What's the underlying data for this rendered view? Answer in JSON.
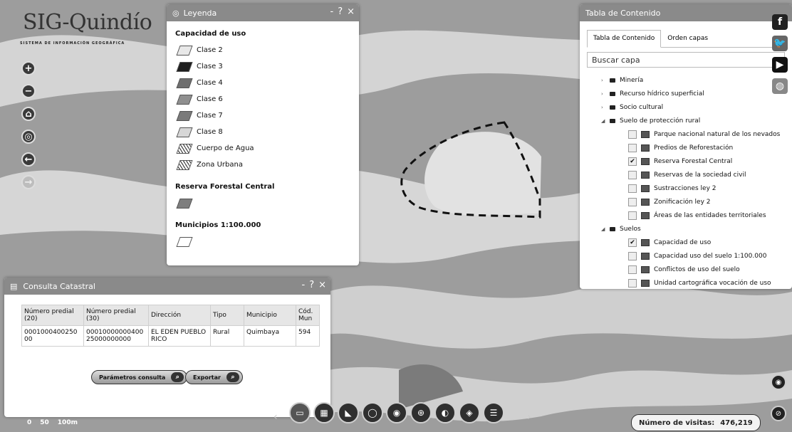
{
  "logo": {
    "title": "SIG-Quindío",
    "subtitle": "SISTEMA DE INFORMACIÓN GEOGRÁFICA"
  },
  "map_controls": [
    {
      "name": "zoom-in-button",
      "glyph": "+"
    },
    {
      "name": "zoom-out-button",
      "glyph": "−"
    },
    {
      "name": "home-button",
      "glyph": "⌂"
    },
    {
      "name": "locate-button",
      "glyph": "◎"
    },
    {
      "name": "back-button",
      "glyph": "←"
    },
    {
      "name": "forward-button",
      "glyph": "→"
    }
  ],
  "legend": {
    "title": "Leyenda",
    "buttons": [
      "-",
      "?",
      "×"
    ],
    "section1": "Capacidad de uso",
    "classes": [
      {
        "label": "Clase 2",
        "color": "#e8e8e8"
      },
      {
        "label": "Clase 3",
        "color": "#1e1e1e"
      },
      {
        "label": "Clase 4",
        "color": "#6f6f6f"
      },
      {
        "label": "Clase 6",
        "color": "#8f8f8f"
      },
      {
        "label": "Clase 7",
        "color": "#7a7a7a"
      },
      {
        "label": "Clase 8",
        "color": "#d7d7d7"
      },
      {
        "label": "Cuerpo de Agua",
        "color": "hatch"
      },
      {
        "label": "Zona Urbana",
        "color": "hatch"
      }
    ],
    "section2": "Reserva Forestal Central",
    "section3": "Municipios 1:100.000"
  },
  "toc": {
    "title": "Tabla de Contenido",
    "tabs": [
      "Tabla de Contenido",
      "Orden capas"
    ],
    "search_placeholder": "Buscar capa",
    "groups": [
      {
        "label": "Minería",
        "expanded": false
      },
      {
        "label": "Recurso hídrico superficial",
        "expanded": false
      },
      {
        "label": "Socio cultural",
        "expanded": false
      },
      {
        "label": "Suelo de protección rural",
        "expanded": true
      }
    ],
    "suelo_children": [
      {
        "label": "Parque nacional natural de los nevados",
        "checked": false
      },
      {
        "label": "Predios de Reforestación",
        "checked": false
      },
      {
        "label": "Reserva Forestal Central",
        "checked": true
      },
      {
        "label": "Reservas de la sociedad civil",
        "checked": false
      },
      {
        "label": "Sustracciones ley 2",
        "checked": false
      },
      {
        "label": "Zonificación ley 2",
        "checked": false
      },
      {
        "label": "Áreas de las entidades territoriales",
        "checked": false
      }
    ],
    "suelos_group": "Suelos",
    "suelos_children": [
      {
        "label": "Capacidad de uso",
        "checked": true
      },
      {
        "label": "Capacidad uso del suelo 1:100.000",
        "checked": false
      },
      {
        "label": "Conflictos de uso del suelo",
        "checked": false
      },
      {
        "label": "Unidad cartográfica vocación de uso",
        "checked": false
      }
    ]
  },
  "social": [
    {
      "name": "facebook-icon",
      "glyph": "f",
      "color": "#222"
    },
    {
      "name": "twitter-icon",
      "glyph": "🐦",
      "color": "#666"
    },
    {
      "name": "youtube-icon",
      "glyph": "▶",
      "color": "#111"
    },
    {
      "name": "map-share-icon",
      "glyph": "◍",
      "color": "#888"
    }
  ],
  "catastral": {
    "title": "Consulta Catastral",
    "buttons": [
      "-",
      "?",
      "×"
    ],
    "headers": [
      "Número predial (20)",
      "Número predial (30)",
      "Dirección",
      "Tipo",
      "Municipio",
      "Cód. Mun"
    ],
    "rows": [
      [
        "000100040025000",
        "0001000000040025000000000",
        "EL EDEN PUEBLO RICO",
        "Rural",
        "Quimbaya",
        "594"
      ]
    ],
    "btn_params": "Parámetros consulta",
    "btn_export": "Exportar"
  },
  "toolbar": [
    {
      "name": "layers-tool-button",
      "glyph": "▭",
      "active": true
    },
    {
      "name": "grid-tool-button",
      "glyph": "▦"
    },
    {
      "name": "measure-tool-button",
      "glyph": "◣"
    },
    {
      "name": "draw-tool-button",
      "glyph": "◯"
    },
    {
      "name": "identify-tool-button",
      "glyph": "◉"
    },
    {
      "name": "search-tool-button",
      "glyph": "⊕"
    },
    {
      "name": "globe-tool-button",
      "glyph": "◐"
    },
    {
      "name": "print-tool-button",
      "glyph": "◈"
    },
    {
      "name": "list-tool-button",
      "glyph": "☰"
    }
  ],
  "scale": {
    "labels": [
      "0",
      "50",
      "100m"
    ]
  },
  "visits": {
    "label": "Número de visitas:",
    "value": "476,219"
  }
}
